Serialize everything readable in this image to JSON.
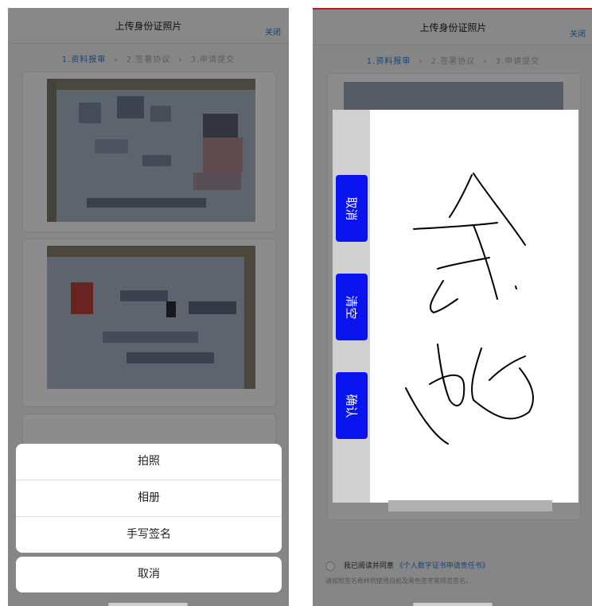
{
  "left": {
    "nav": {
      "title": "上传身份证照片",
      "close": "关闭"
    },
    "steps": {
      "s1": "1.资料报审",
      "s2": "2.签署协议",
      "s3": "3.申请提交",
      "chev": "›"
    },
    "action_sheet": {
      "take_photo": "拍照",
      "album": "相册",
      "handwrite": "手写签名",
      "cancel": "取消"
    }
  },
  "right": {
    "nav": {
      "title": "上传身份证照片",
      "close": "关闭"
    },
    "steps": {
      "s1": "1.资料报审",
      "s2": "2.签署协议",
      "s3": "3.申请提交",
      "chev": "›"
    },
    "signature": {
      "cancel": "取消",
      "clear": "清空",
      "confirm": "确认"
    },
    "agreement": {
      "prefix": "我已阅读并同意",
      "link": "《个人数字证书申请责任书》",
      "hint": "请按照签名框样例使用白纸及黑色签字笔规范签名。"
    }
  },
  "colors": {
    "accent": "#2a7cd8",
    "signature_button": "#0a14ee",
    "overlay": "rgba(0,0,0,0.45)"
  },
  "icons": [
    "chevron-right-icon",
    "radio-icon"
  ]
}
